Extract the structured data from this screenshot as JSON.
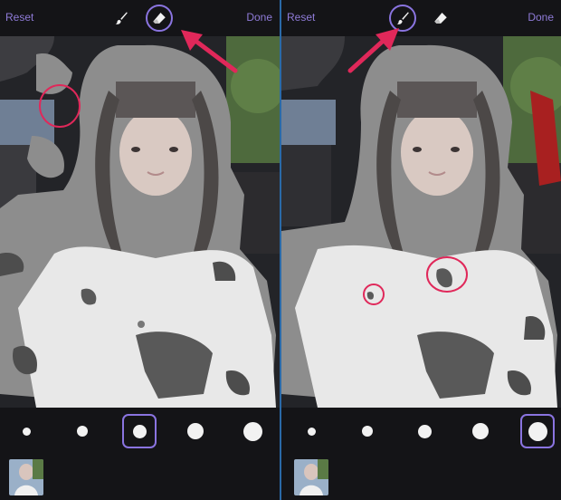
{
  "panels": [
    {
      "reset_label": "Reset",
      "done_label": "Done",
      "active_tool": "eraser",
      "selected_size_index": 2
    },
    {
      "reset_label": "Reset",
      "done_label": "Done",
      "active_tool": "brush",
      "selected_size_index": 4
    }
  ],
  "tools": [
    {
      "name": "brush",
      "icon": "brush-icon"
    },
    {
      "name": "eraser",
      "icon": "eraser-icon"
    }
  ],
  "brush_sizes": [
    "size-1",
    "size-2",
    "size-3",
    "size-4",
    "size-5"
  ],
  "colors": {
    "accent": "#8a74e0",
    "annotation": "#e0285a",
    "label": "#8f7bd8"
  }
}
